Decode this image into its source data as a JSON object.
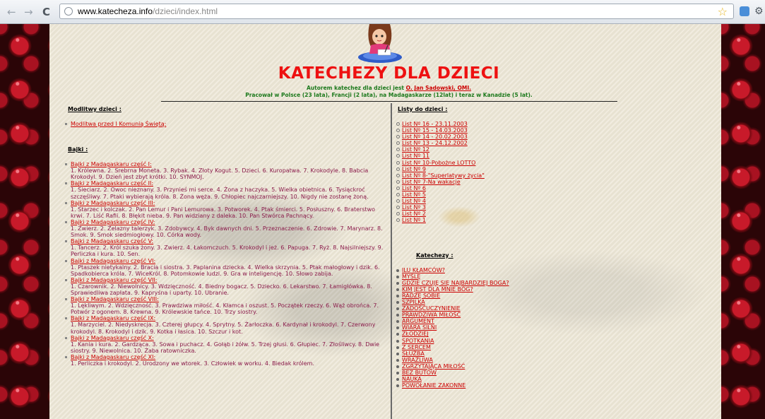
{
  "browser": {
    "back_icon": "arrow-left-icon",
    "forward_icon": "arrow-right-icon",
    "reload_icon": "reload-icon",
    "back_glyph": "←",
    "forward_glyph": "→",
    "reload_glyph": "C",
    "url_host": "www.katecheza.info",
    "url_path": "/dzieci/index.html",
    "bookmark_icon": "star-icon",
    "bookmark_glyph": "☆",
    "wrench_glyph": "⚙"
  },
  "header": {
    "title": "KATECHEZY DLA DZIECI",
    "author_prefix": "Autorem katechez dla dzieci jest ",
    "author_name": "O. Jan Sadowski, OMI.",
    "bio": "Pracował w Polsce (23 lata), Francji (2 lata), na Madagaskarze (12lat) i teraz w Kanadzie (5 lat)."
  },
  "colors": {
    "title": "#ee1111",
    "subtitle": "#1d7a1d",
    "link": "#cc0000",
    "tale_text": "#8a1a4a",
    "page_bg": "#ece6d5",
    "side_bg": "#310709"
  },
  "prayers": {
    "heading": "Modlitwy dzieci :",
    "items": [
      "Modlitwa przed I Komunią Świętą:"
    ]
  },
  "tales": {
    "heading": "Bajki :",
    "items": [
      {
        "title": "Bajki z Madagaskaru część I:",
        "text": "1. Królewna. 2. Srebrna Moneta. 3. Rybak. 4. Złoty Kogut. 5. Dzieci. 6. Kuropatwa. 7. Krokodyle. 8. Babcia Krokodyl. 9. Dzień jest zbyt krótki. 10. SYNMOJ."
      },
      {
        "title": "Bajki z Madagaskaru część II:",
        "text": "1. Sieciarz. 2. Owoc nieznany. 3. Przynieś mi serce. 4. Żona z haczyka. 5. Wielka obietnica. 6. Tysiąckroć szczęśliwy. 7. Ptaki wybierają króla. 8. Żona węża. 9. Chłopiec najczarniejszy. 10. Nigdy nie zostanę żoną."
      },
      {
        "title": "Bajki z Madagaskaru część III:",
        "text": "1. Starzec i kolczak. 2. Pan Lemur i Pani Lemurowa. 3. Potworek. 4. Ptak śmierci. 5. Posłuszny. 6. Braterstwo krwi. 7. Liść Rafii. 8. Błękit nieba. 9. Pan widziany z daleka. 10. Pan Stwórca Pachnący."
      },
      {
        "title": "Bajki z Madagaskaru część IV:",
        "text": "1. Zwierz. 2. Żelazny talerzyk. 3. Zdobywcy. 4. Byk dawnych dni. 5. Przeznaczenie. 6. Zdrowie. 7. Marynarz. 8. Smok. 9. Smok siedmiogłowy. 10. Córka wody."
      },
      {
        "title": "Bajki z Madagaskaru część V:",
        "text": "1. Tancerz. 2. Król szuka żony. 3. Zwierz. 4. Łakomczuch. 5. Krokodyl i jeż. 6. Papuga. 7. Ryż. 8. Najsilniejszy. 9. Perliczka i kura. 10. Sen."
      },
      {
        "title": "Bajki z Madagaskaru część VI:",
        "text": "1. Ptaszek nietykalny. 2. Bracia i siostra. 3. Paplanina dziecka. 4. Wielka skrzynia. 5. Ptak małogłowy i dzik. 6. Spadkobierca króla. 7. WiceKról. 8. Potomkowie ludzi. 9. Gra w inteligencję. 10. Słowo zabija."
      },
      {
        "title": "Bajki z Madagaskaru część VII:",
        "text": "1. Czarownik. 2. Niewolnicy. 3. Wdzięczność. 4. Biedny bogacz. 5. Dziecko. 6. Lekarstwo. 7. Łamigłówka. 8. Sprawiedliwa zapłata. 9. Kapryśna i uparty. 10. Ubranie."
      },
      {
        "title": "Bajki z Madagaskaru część VIII:",
        "text": "1. Lękliwym. 2. Wdzięczność. 3. Prawdziwa miłość. 4. Kłamca i oszust. 5. Początek rzeczy. 6. Wąż obrońca. 7. Potwór z ogonem. 8. Krewna. 9. Królewskie tańce. 10. Trzy siostry."
      },
      {
        "title": "Bajki z Madagaskaru część IX:",
        "text": "1. Marzyciel. 2. Niedyskrecja. 3. Czterej głupcy. 4. Sprytny. 5. Żarłoczka. 6. Kardynał i krokodyl. 7. Czerwony krokodyl. 8. Krokodyl i dzik. 9. Kotka i łasica. 10. Szczur i kot."
      },
      {
        "title": "Bajki z Madagaskaru część X:",
        "text": "1. Kania i kura. 2. Gardząca. 3. Sowa i puchacz. 4. Gołąb i żółw. 5. Trzej głusi. 6. Głupiec. 7. Złośliwcy. 8. Dwie siostry. 9. Niewolnica. 10. Żaba ratowniczka."
      },
      {
        "title": "Bajki z Madagaskaru część XI:",
        "text": "1. Perliczka i krokodyl. 2. Urodzony we wtorek. 3. Człowiek w worku. 4. Biedak królem."
      }
    ]
  },
  "letters": {
    "heading": "Listy do dzieci :",
    "items": [
      "List Nº 16 - 23.11.2003",
      "List Nº 15 - 14.03.2003",
      "List Nº 14 - 20.02.2003",
      "List Nº 13 - 24.12.2002",
      "List Nº 12",
      "List Nº 11",
      "List Nº 10-Pobożne LOTTO",
      "List Nº 9",
      "List Nº 8-\"Superlatywy życia\"",
      "List Nº 7-Na wakacje",
      "List Nº 6",
      "List Nº 5",
      "List Nº 4",
      "List Nº 3",
      "List Nº 2",
      "List Nº 1"
    ]
  },
  "catecheses": {
    "heading": "Katechezy :",
    "items": [
      "ILU KŁAMCÓW?",
      "MYŚLĘ",
      "GDZIE CZUJĘ SIĘ NAJBARDZIEJ BOGA?",
      "KIM JEST DLA MNIE BÓG?",
      "RADZĘ SOBIE",
      "SZPILKA",
      "ZADOŚĆUCZYNIENIE",
      "PRAWDZIWA MIŁOŚĆ",
      "ARGUMENT",
      "WIARA SILNI",
      "ZŁODZIEJ",
      "SPOTKANIA",
      "Z SERCEM",
      "SŁUŻBA",
      "WRAŻLIWA",
      "ZGRZYTAJĄCA MIŁOŚĆ",
      "BEZ BUTÓW",
      "NAUKA",
      "POWOŁANIE ZAKONNE"
    ]
  }
}
